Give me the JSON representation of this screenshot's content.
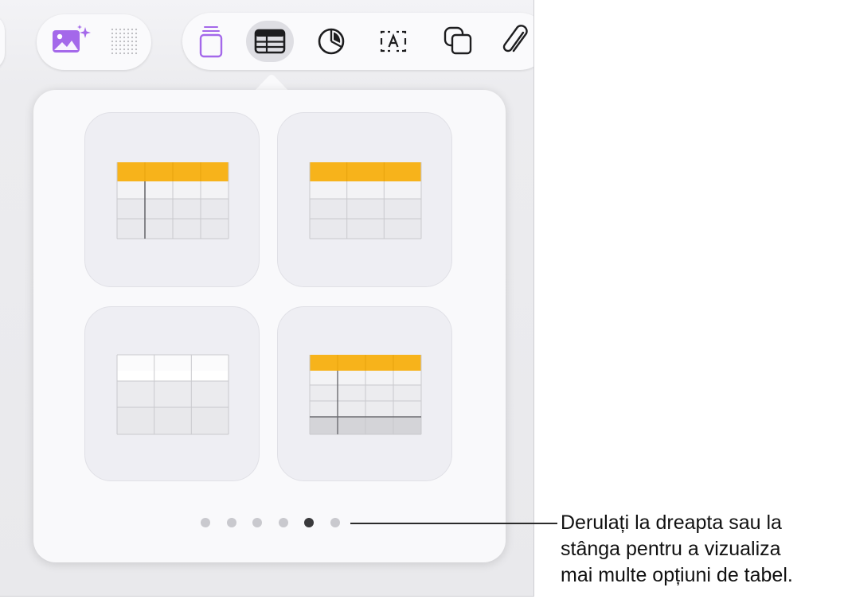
{
  "toolbar": {
    "media_buttons": [
      {
        "name": "media-button",
        "icon": "photo-sparkle-icon"
      },
      {
        "name": "drawing-grid-button",
        "icon": "dot-grid-icon"
      }
    ],
    "insert_buttons": [
      {
        "name": "text-stack-button",
        "icon": "stack-rectangle-icon"
      },
      {
        "name": "table-button",
        "icon": "table-icon",
        "selected": true
      },
      {
        "name": "chart-button",
        "icon": "pie-chart-icon"
      },
      {
        "name": "text-box-button",
        "icon": "text-box-icon"
      },
      {
        "name": "shapes-button",
        "icon": "overlapping-squares-icon"
      },
      {
        "name": "attachment-button",
        "icon": "paperclip-icon"
      }
    ],
    "accent_color": "#9b59e6"
  },
  "table_styles": [
    {
      "name": "table-style-header-row-and-column",
      "header_color": "#f7b31b"
    },
    {
      "name": "table-style-header-row",
      "header_color": "#f7b31b"
    },
    {
      "name": "table-style-plain",
      "header_color": null
    },
    {
      "name": "table-style-header-footer",
      "header_color": "#f7b31b"
    }
  ],
  "pagination": {
    "total_pages": 6,
    "current_page": 5
  },
  "callout": {
    "lines": [
      "Derulați la dreapta sau la",
      "stânga pentru a vizualiza",
      "mai multe opțiuni de tabel."
    ]
  }
}
